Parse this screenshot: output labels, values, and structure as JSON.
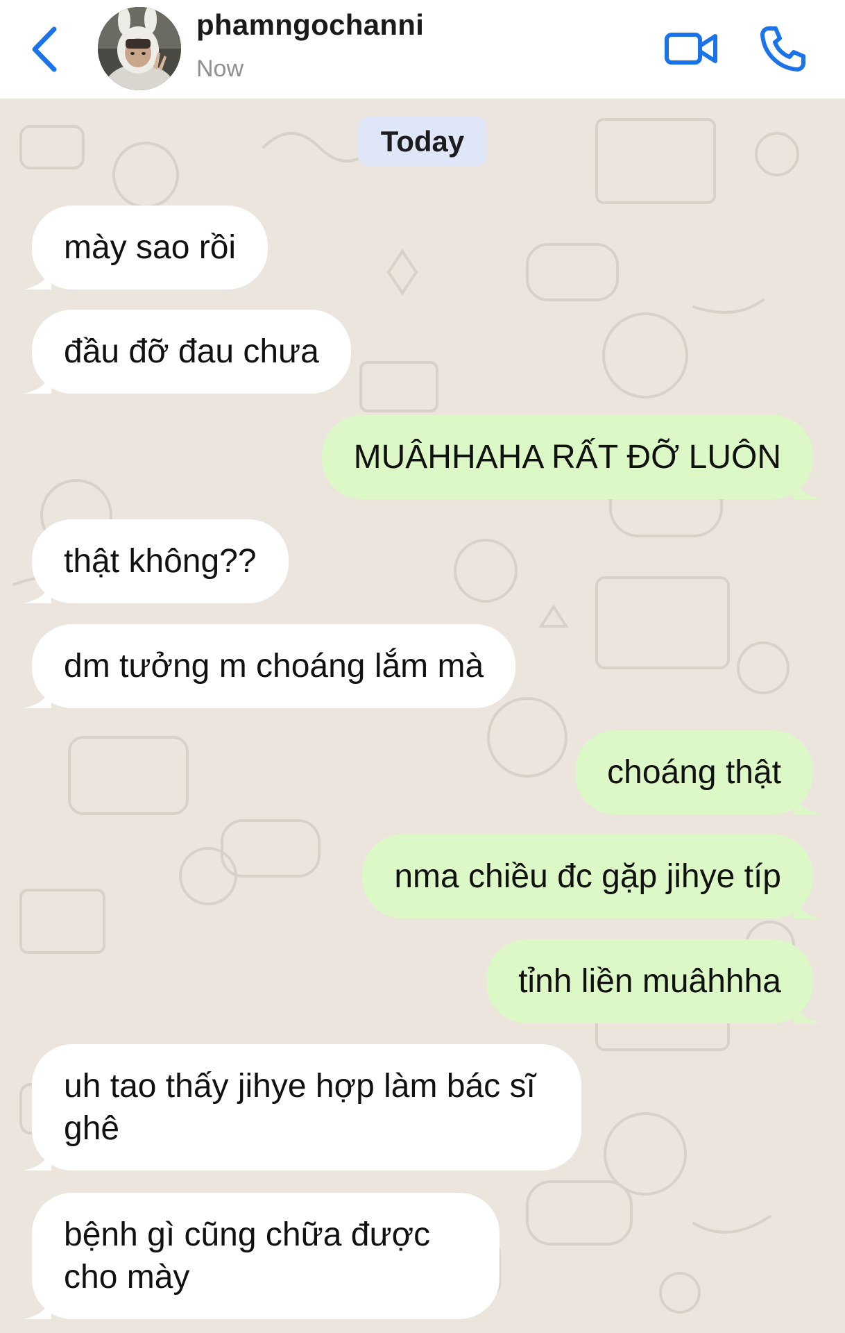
{
  "header": {
    "back_icon": "chevron-left-icon",
    "contact_name": "phamngochanni",
    "status": "Now",
    "video_call_icon": "video-camera-icon",
    "voice_call_icon": "phone-icon",
    "accent_color": "#1a73e8"
  },
  "chat": {
    "date_label": "Today",
    "incoming_color": "#ffffff",
    "outgoing_color": "#dcf8c6",
    "messages": [
      {
        "direction": "incoming",
        "text": "mày sao rồi"
      },
      {
        "direction": "incoming",
        "text": "đầu đỡ đau chưa"
      },
      {
        "direction": "outgoing",
        "text": "MUÂHHAHA RẤT ĐỠ LUÔN"
      },
      {
        "direction": "incoming",
        "text": "thật không??"
      },
      {
        "direction": "incoming",
        "text": "dm tưởng m choáng lắm mà"
      },
      {
        "direction": "outgoing",
        "text": "choáng thật"
      },
      {
        "direction": "outgoing",
        "text": "nma chiều đc gặp jihye típ"
      },
      {
        "direction": "outgoing",
        "text": "tỉnh liền muâhhha"
      },
      {
        "direction": "incoming",
        "text": "uh tao thấy jihye hợp làm bác sĩ ghê"
      },
      {
        "direction": "incoming",
        "text": "bệnh gì cũng chữa được cho mày"
      }
    ]
  }
}
